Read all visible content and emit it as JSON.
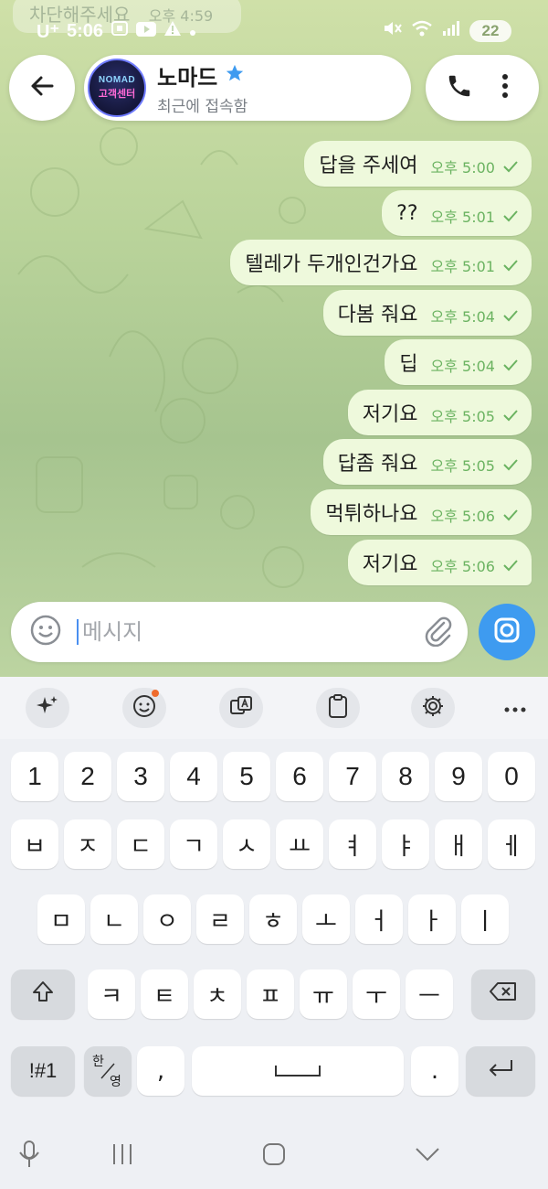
{
  "status_bar": {
    "carrier": "U⁺",
    "time": "5:06",
    "battery": "22"
  },
  "ghost_message": {
    "text": "차단해주세요",
    "time": "오후 4:59"
  },
  "header": {
    "title": "노마드",
    "subtitle": "최근에 접속함",
    "avatar_top": "NOMAD",
    "avatar_mid": "고객센터",
    "star_color": "#3e9bf0"
  },
  "messages": [
    {
      "text": "답을 주세여",
      "time": "오후 5:00"
    },
    {
      "text": "??",
      "time": "오후 5:01"
    },
    {
      "text": "텔레가 두개인건가요",
      "time": "오후 5:01"
    },
    {
      "text": "다봄 줘요",
      "time": "오후 5:04"
    },
    {
      "text": "딥",
      "time": "오후 5:04"
    },
    {
      "text": "저기요",
      "time": "오후 5:05"
    },
    {
      "text": "답좀 줘요",
      "time": "오후 5:05"
    },
    {
      "text": "먹튀하나요",
      "time": "오후 5:06"
    },
    {
      "text": "저기요",
      "time": "오후 5:06"
    }
  ],
  "input": {
    "placeholder": "메시지"
  },
  "keyboard": {
    "numbers": [
      "1",
      "2",
      "3",
      "4",
      "5",
      "6",
      "7",
      "8",
      "9",
      "0"
    ],
    "row1": [
      "ㅂ",
      "ㅈ",
      "ㄷ",
      "ㄱ",
      "ㅅ",
      "ㅛ",
      "ㅕ",
      "ㅑ",
      "ㅐ",
      "ㅔ"
    ],
    "row2": [
      "ㅁ",
      "ㄴ",
      "ㅇ",
      "ㄹ",
      "ㅎ",
      "ㅗ",
      "ㅓ",
      "ㅏ",
      "ㅣ"
    ],
    "row3": [
      "ㅋ",
      "ㅌ",
      "ㅊ",
      "ㅍ",
      "ㅠ",
      "ㅜ",
      "ㅡ"
    ],
    "symbols_label": "!#1",
    "lang_top": "한",
    "lang_bottom": "영",
    "comma": ",",
    "period": "."
  },
  "colors": {
    "accent": "#3e9bf0",
    "bubble": "#eef9dc",
    "read_check": "#6bb361"
  },
  "icons": {
    "back": "arrow-left-icon",
    "phone": "phone-icon",
    "menu": "more-vertical-icon",
    "emoji": "emoji-icon",
    "attach": "paperclip-icon",
    "camera": "camera-icon"
  }
}
